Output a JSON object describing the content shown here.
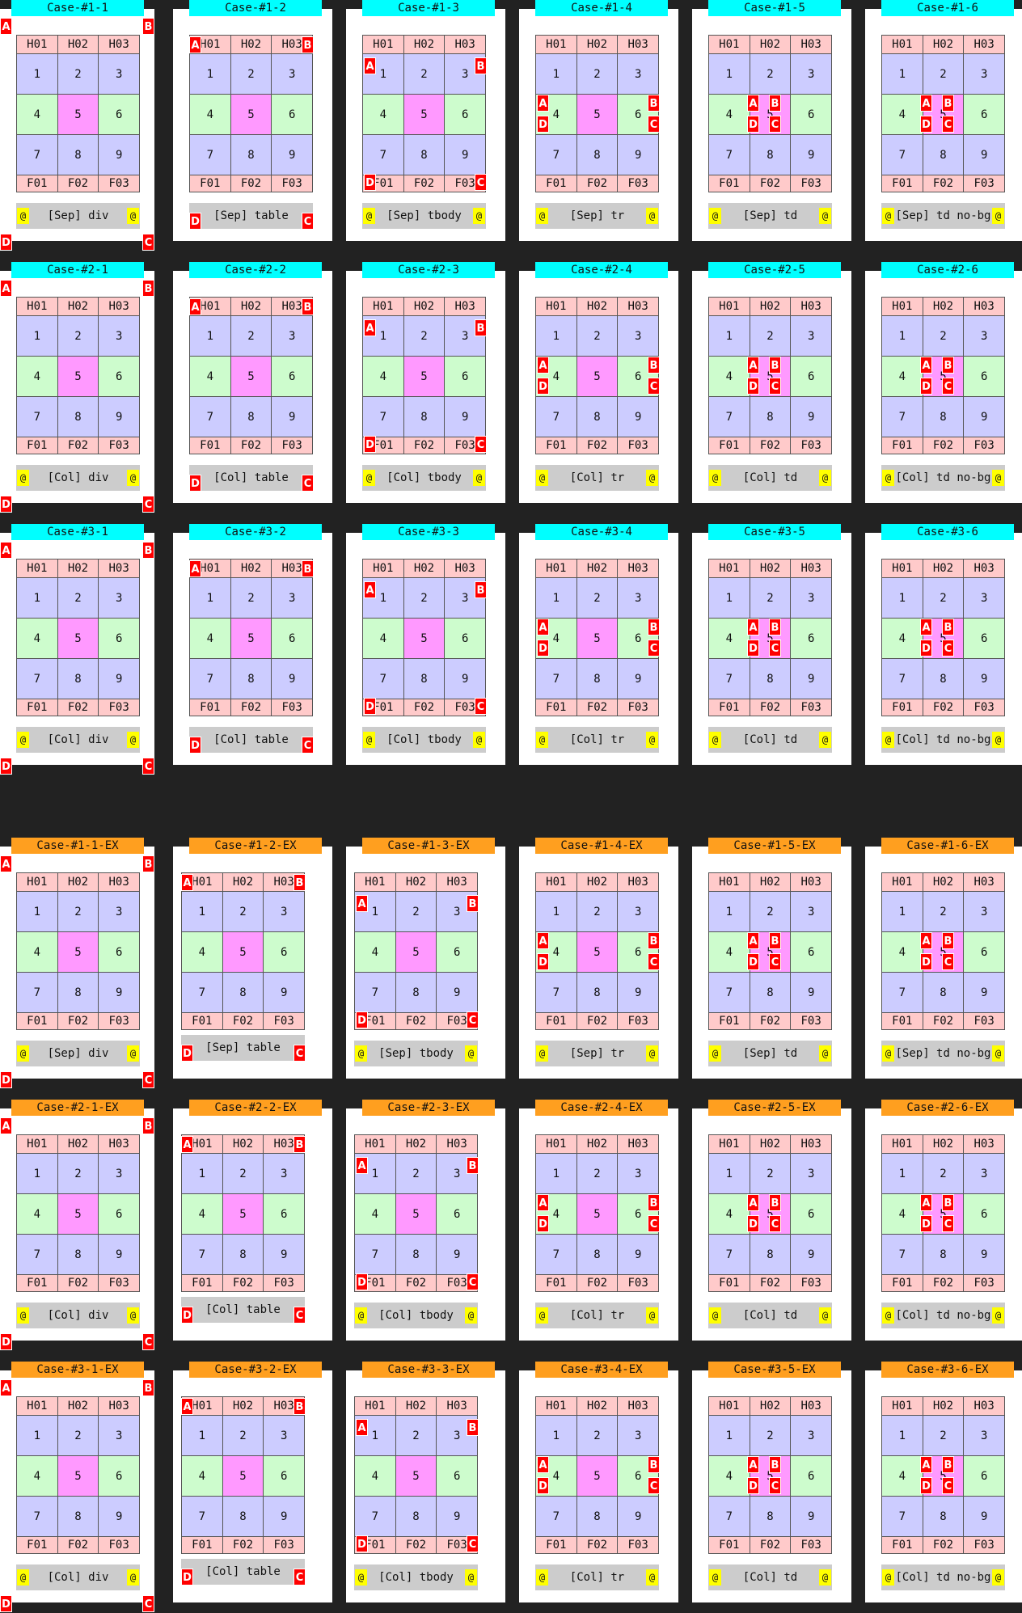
{
  "headers": [
    "H01",
    "H02",
    "H03"
  ],
  "rows": [
    [
      "1",
      "2",
      "3"
    ],
    [
      "4",
      "5",
      "6"
    ],
    [
      "7",
      "8",
      "9"
    ]
  ],
  "footers": [
    "F01",
    "F02",
    "F03"
  ],
  "at_sign": "@",
  "markers": [
    "A",
    "B",
    "C",
    "D"
  ],
  "colors": {
    "page_bg": "#222222",
    "card_bg": "#ffffff",
    "cyan_header": "#00ffff",
    "orange_header": "#ff9f1f",
    "head_cell": "#ffcaca",
    "body_cell": "#ccccff",
    "green_cell": "#cdfccd",
    "pink_cell": "#ff99ff",
    "caption_bg": "#cccccc",
    "marker": "#ff0000",
    "at_bg": "#ffff00"
  },
  "cases": [
    {
      "title": "Case-#1-1",
      "caption": "[Sep] div"
    },
    {
      "title": "Case-#1-2",
      "caption": "[Sep] table"
    },
    {
      "title": "Case-#1-3",
      "caption": "[Sep] tbody"
    },
    {
      "title": "Case-#1-4",
      "caption": "[Sep] tr"
    },
    {
      "title": "Case-#1-5",
      "caption": "[Sep] td"
    },
    {
      "title": "Case-#1-6",
      "caption": "[Sep] td no-bg"
    },
    {
      "title": "Case-#2-1",
      "caption": "[Col] div"
    },
    {
      "title": "Case-#2-2",
      "caption": "[Col] table"
    },
    {
      "title": "Case-#2-3",
      "caption": "[Col] tbody"
    },
    {
      "title": "Case-#2-4",
      "caption": "[Col] tr"
    },
    {
      "title": "Case-#2-5",
      "caption": "[Col] td"
    },
    {
      "title": "Case-#2-6",
      "caption": "[Col] td no-bg"
    },
    {
      "title": "Case-#3-1",
      "caption": "[Col] div"
    },
    {
      "title": "Case-#3-2",
      "caption": "[Col] table"
    },
    {
      "title": "Case-#3-3",
      "caption": "[Col] tbody"
    },
    {
      "title": "Case-#3-4",
      "caption": "[Col] tr"
    },
    {
      "title": "Case-#3-5",
      "caption": "[Col] td"
    },
    {
      "title": "Case-#3-6",
      "caption": "[Col] td no-bg"
    },
    {
      "title": "Case-#1-1-EX",
      "caption": "[Sep] div"
    },
    {
      "title": "Case-#1-2-EX",
      "caption": "[Sep] table"
    },
    {
      "title": "Case-#1-3-EX",
      "caption": "[Sep] tbody"
    },
    {
      "title": "Case-#1-4-EX",
      "caption": "[Sep] tr"
    },
    {
      "title": "Case-#1-5-EX",
      "caption": "[Sep] td"
    },
    {
      "title": "Case-#1-6-EX",
      "caption": "[Sep] td no-bg"
    },
    {
      "title": "Case-#2-1-EX",
      "caption": "[Col] div"
    },
    {
      "title": "Case-#2-2-EX",
      "caption": "[Col] table"
    },
    {
      "title": "Case-#2-3-EX",
      "caption": "[Col] tbody"
    },
    {
      "title": "Case-#2-4-EX",
      "caption": "[Col] tr"
    },
    {
      "title": "Case-#2-5-EX",
      "caption": "[Col] td"
    },
    {
      "title": "Case-#2-6-EX",
      "caption": "[Col] td no-bg"
    },
    {
      "title": "Case-#3-1-EX",
      "caption": "[Col] div"
    },
    {
      "title": "Case-#3-2-EX",
      "caption": "[Col] table"
    },
    {
      "title": "Case-#3-3-EX",
      "caption": "[Col] tbody"
    },
    {
      "title": "Case-#3-4-EX",
      "caption": "[Col] tr"
    },
    {
      "title": "Case-#3-5-EX",
      "caption": "[Col] td"
    },
    {
      "title": "Case-#3-6-EX",
      "caption": "[Col] td no-bg"
    }
  ]
}
